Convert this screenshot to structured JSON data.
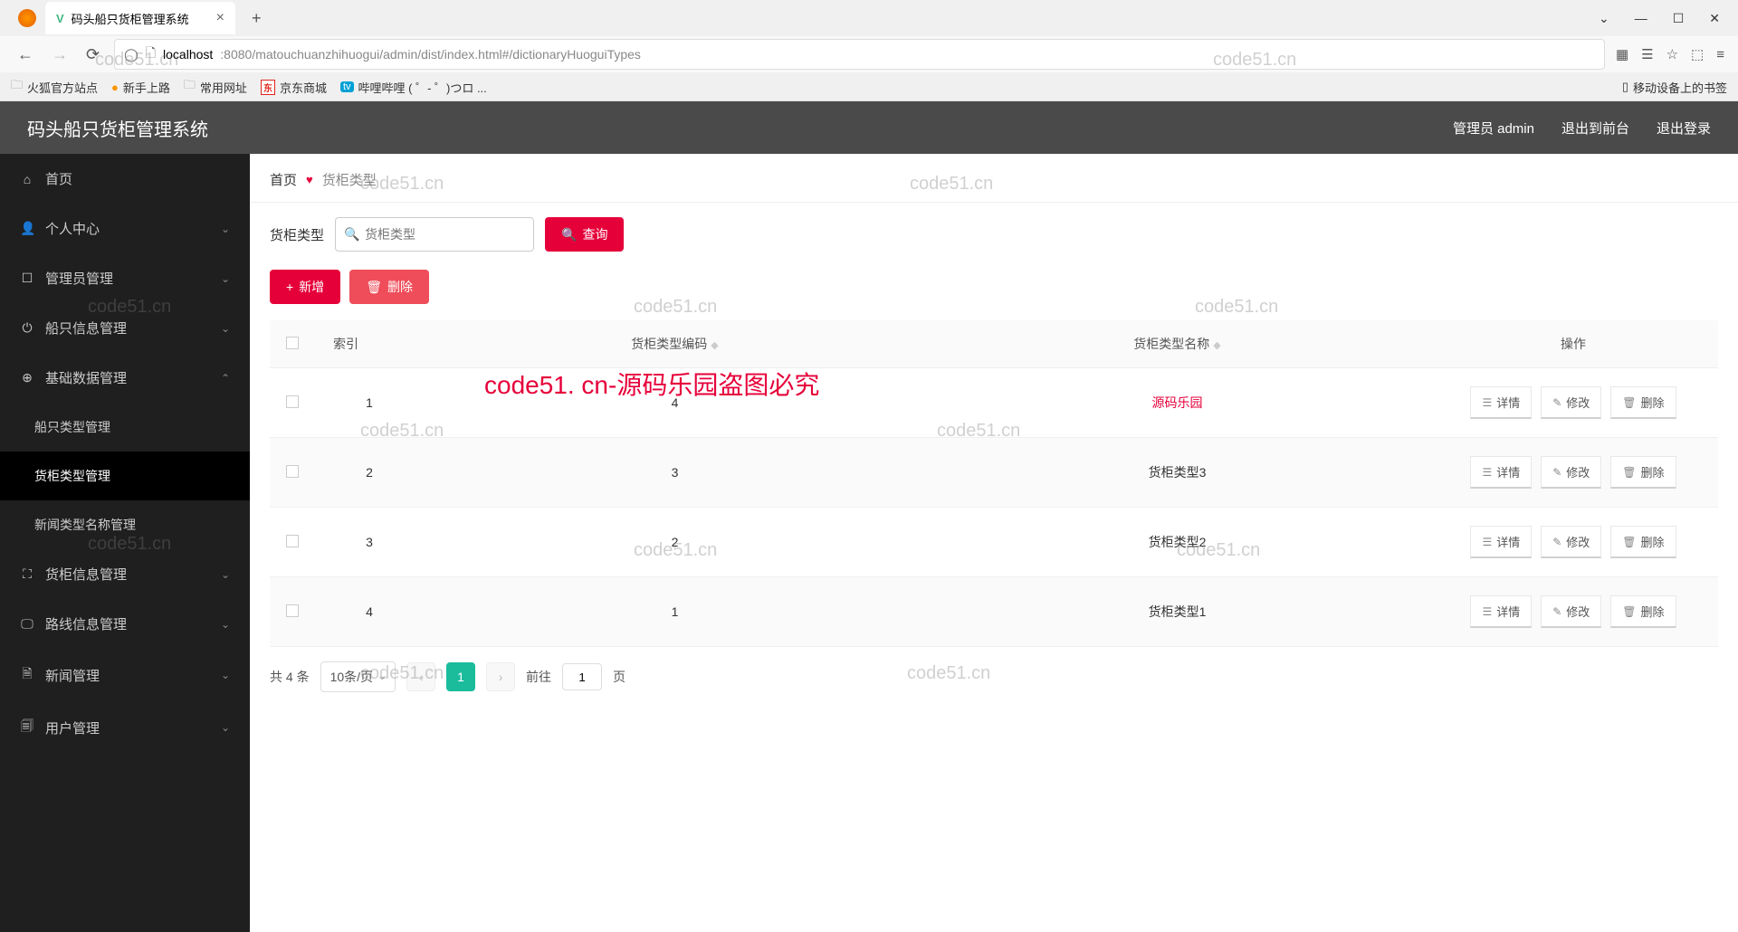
{
  "browser": {
    "tab_title": "码头船只货柜管理系统",
    "url_host": "localhost",
    "url_port_path": ":8080/matouchuanzhihuogui/admin/dist/index.html#/dictionaryHuoguiTypes",
    "bookmarks": {
      "b1": "火狐官方站点",
      "b2": "新手上路",
      "b3": "常用网址",
      "b4": "京东商城",
      "b5": "哔哩哔哩 (  ゜- ゜)つロ ...",
      "mobile": "移动设备上的书签"
    }
  },
  "header": {
    "title": "码头船只货柜管理系统",
    "user": "管理员 admin",
    "to_front": "退出到前台",
    "logout": "退出登录"
  },
  "sidebar": {
    "home": "首页",
    "personal": "个人中心",
    "admin_mgmt": "管理员管理",
    "ship_info": "船只信息管理",
    "base_data": "基础数据管理",
    "sub_ship_type": "船只类型管理",
    "sub_container_type": "货柜类型管理",
    "sub_news_type": "新闻类型名称管理",
    "container_info": "货柜信息管理",
    "route_info": "路线信息管理",
    "news_mgmt": "新闻管理",
    "user_mgmt": "用户管理"
  },
  "breadcrumb": {
    "home": "首页",
    "current": "货柜类型"
  },
  "search": {
    "label": "货柜类型",
    "placeholder": "货柜类型",
    "query_btn": "查询"
  },
  "actions": {
    "add": "新增",
    "delete": "删除"
  },
  "table": {
    "headers": {
      "index": "索引",
      "code": "货柜类型编码",
      "name": "货柜类型名称",
      "op": "操作"
    },
    "ops": {
      "detail": "详情",
      "edit": "修改",
      "del": "删除"
    },
    "rows": [
      {
        "idx": "1",
        "code": "4",
        "name": "源码乐园"
      },
      {
        "idx": "2",
        "code": "3",
        "name": "货柜类型3"
      },
      {
        "idx": "3",
        "code": "2",
        "name": "货柜类型2"
      },
      {
        "idx": "4",
        "code": "1",
        "name": "货柜类型1"
      }
    ]
  },
  "pager": {
    "total": "共 4 条",
    "page_size": "10条/页",
    "current": "1",
    "goto_prefix": "前往",
    "goto_val": "1",
    "goto_suffix": "页"
  },
  "watermarks": {
    "wm": "code51.cn",
    "big": "code51. cn-源码乐园盗图必究"
  }
}
